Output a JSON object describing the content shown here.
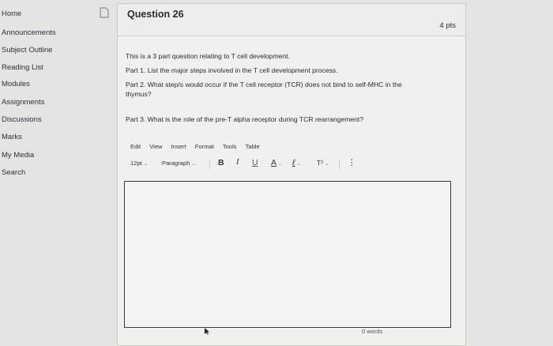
{
  "sidebar": {
    "items": [
      {
        "label": "Home"
      },
      {
        "label": "Announcements"
      },
      {
        "label": "Subject Outline"
      },
      {
        "label": "Reading List"
      },
      {
        "label": "Modules"
      },
      {
        "label": "Assignments"
      },
      {
        "label": "Discussions"
      },
      {
        "label": "Marks"
      },
      {
        "label": "My Media"
      },
      {
        "label": "Search"
      }
    ]
  },
  "question": {
    "title": "Question 26",
    "points": "4 pts",
    "intro": "This is a 3 part question relating to T cell development.",
    "part1": "Part 1. List the major steps involved in the T cell development process.",
    "part2_line1": "Part 2. What step/s would occur if the T cell receptor (TCR) does not bind to self-MHC in the",
    "part2_line2": "thymus?",
    "part3": "Part 3. What is the role of the pre-T alpha receptor during TCR rearrangement?"
  },
  "editor": {
    "menu": [
      "Edit",
      "View",
      "Insert",
      "Format",
      "Tools",
      "Table"
    ],
    "font_size": "12pt",
    "paragraph": "Paragraph",
    "bold": "B",
    "italic": "I",
    "underline": "U",
    "text_color": "A",
    "highlight": "ℓ",
    "superscript": "T²",
    "more": "⋮",
    "content": "",
    "word_count": "0 words"
  }
}
